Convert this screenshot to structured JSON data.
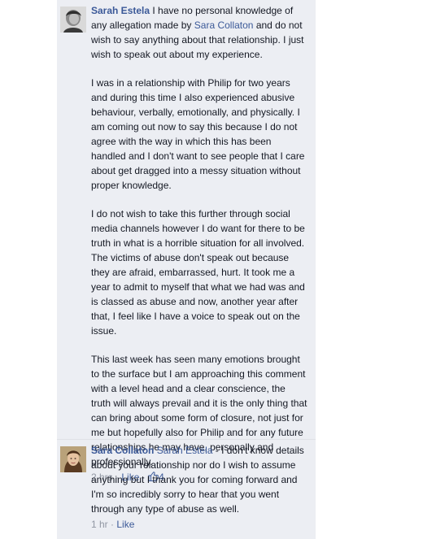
{
  "comments": [
    {
      "author": "Sarah Estela",
      "text_before_mention": "I have no personal knowledge of any allegation made by",
      "mention": "Sara Collaton",
      "text_after_mention": "and do not wish to say anything about that relationship. I just wish to speak out about my experience.",
      "paragraphs": [
        "I was in a relationship with Philip for two years and during this time I also experienced abusive behaviour, verbally, emotionally, and physically. I am coming out now to say this because I do not agree with the way in which this has been handled and I don't want to see people that I care about get dragged into a messy situation without proper knowledge.",
        "I do not wish to take this further through social media channels however I do want for there to be truth in what is a horrible situation for all involved. The victims of abuse don't speak out because they are afraid, embarrassed, hurt. It took me a year to admit to myself that what we had was and is classed as abuse and now, another year after that, I feel like I have a voice to speak out on the issue.",
        "This last week has seen many emotions brought to the surface but I am approaching this comment with a level head and a clear conscience, the truth will always prevail and it is the only thing that can bring about some form of closure, not just for me but hopefully also for Philip and for any future relationships he may have, personally and professionally."
      ],
      "time": "2 hrs",
      "separator": "·",
      "like_label": "Like",
      "like_count": "4"
    },
    {
      "author": "Sara Collaton",
      "mention": "Sarah Estela",
      "text_after_mention": "- I don't know details about your relationship nor do I wish to assume anything but I thank you for coming forward and I'm so incredibly sorry to hear that you went through any type of abuse as well.",
      "time": "1 hr",
      "separator": "·",
      "like_label": "Like"
    }
  ]
}
